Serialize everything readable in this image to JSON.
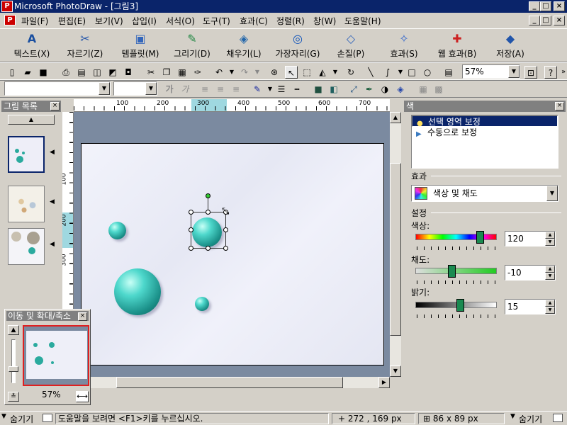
{
  "window": {
    "title": "Microsoft PhotoDraw - [그림3]"
  },
  "menu": [
    "파일(F)",
    "편집(E)",
    "보기(V)",
    "삽입(I)",
    "서식(O)",
    "도구(T)",
    "효과(C)",
    "정렬(R)",
    "창(W)",
    "도움말(H)"
  ],
  "bigtoolbar": [
    {
      "label": "텍스트(X)",
      "icon": "text-icon"
    },
    {
      "label": "자르기(Z)",
      "icon": "scissors-icon"
    },
    {
      "label": "템플릿(M)",
      "icon": "template-icon"
    },
    {
      "label": "그리기(D)",
      "icon": "draw-icon"
    },
    {
      "label": "채우기(L)",
      "icon": "fill-icon"
    },
    {
      "label": "가장자리(G)",
      "icon": "edge-icon"
    },
    {
      "label": "손질(P)",
      "icon": "touchup-icon"
    },
    {
      "label": "효과(S)",
      "icon": "effects-icon"
    },
    {
      "label": "웹 효과(B)",
      "icon": "web-effects-icon"
    },
    {
      "label": "저장(A)",
      "icon": "save-icon"
    }
  ],
  "zoom": "57%",
  "rulers": {
    "top": [
      "100",
      "200",
      "300",
      "400",
      "500",
      "600",
      "700"
    ],
    "left": [
      "100",
      "200",
      "300"
    ]
  },
  "leftpanel": {
    "title": "그림 목록"
  },
  "navigator": {
    "title": "이동 및 확대/축소",
    "zoom": "57%"
  },
  "rightpanel": {
    "title": "색",
    "mode_items": [
      "선택 영역 보정",
      "수동으로 보정"
    ],
    "effect_label": "효과",
    "effect_value": "색상 및 채도",
    "settings_label": "설정",
    "hue_label": "색상:",
    "hue_value": "120",
    "sat_label": "채도:",
    "sat_value": "-10",
    "bright_label": "밝기:",
    "bright_value": "15"
  },
  "status": {
    "hide_left": "숨기기",
    "help": "도움말을 보려면 <F1>키를 누르십시오.",
    "coords": "272 , 169  px",
    "size": "86 x 89  px",
    "hide_right": "숨기기"
  }
}
